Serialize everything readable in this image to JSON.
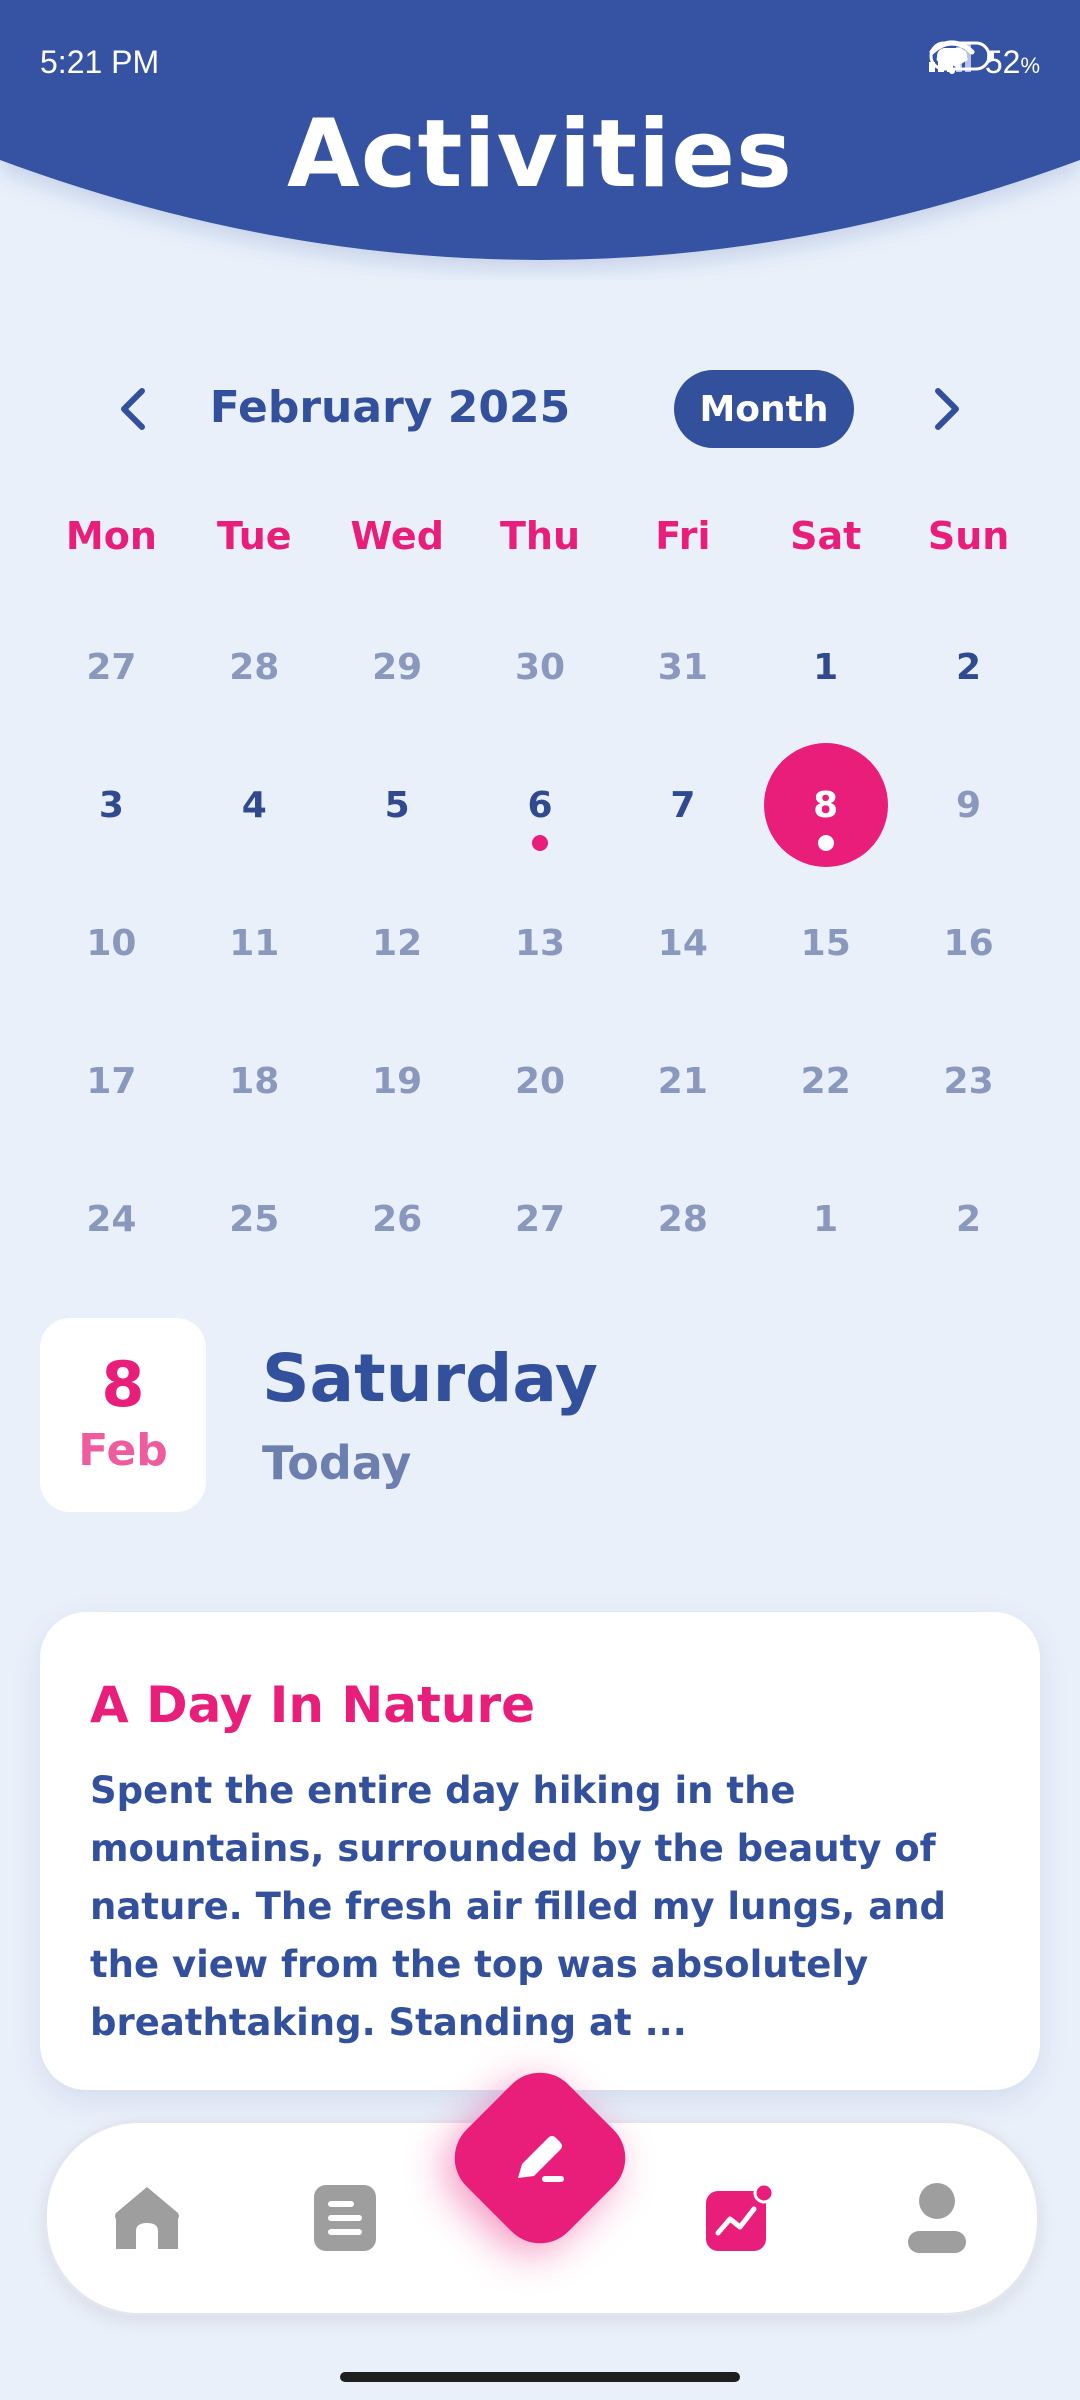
{
  "status_bar": {
    "time": "5:21 PM",
    "battery": "52",
    "battery_unit": "%",
    "icons": [
      "signal-icon",
      "signal-icon",
      "wifi-icon",
      "battery-icon"
    ]
  },
  "header": {
    "title": "Activities"
  },
  "calendar": {
    "month_label": "February 2025",
    "view_toggle": "Month",
    "weekdays": [
      "Mon",
      "Tue",
      "Wed",
      "Thu",
      "Fri",
      "Sat",
      "Sun"
    ],
    "days": [
      "27",
      "28",
      "29",
      "30",
      "31",
      "1",
      "2",
      "3",
      "4",
      "5",
      "6",
      "7",
      "8",
      "9",
      "10",
      "11",
      "12",
      "13",
      "14",
      "15",
      "16",
      "17",
      "18",
      "19",
      "20",
      "21",
      "22",
      "23",
      "24",
      "25",
      "26",
      "27",
      "28",
      "1",
      "2"
    ]
  },
  "selected_date": {
    "day": "8",
    "month": "Feb",
    "weekday": "Saturday",
    "relative": "Today"
  },
  "entry": {
    "title": "A Day In Nature",
    "body": "Spent the entire day hiking in the mountains, surrounded by the beauty of nature. The fresh air filled my lungs, and the view from the top was absolutely breathtaking. Standing at ..."
  },
  "bottom_nav": {
    "items": [
      "home-icon",
      "notes-icon",
      "edit-icon",
      "activity-chart-icon",
      "profile-icon"
    ]
  },
  "colors": {
    "primary": "#33509D",
    "accent": "#E91E7A",
    "background": "#EAF0FA"
  }
}
